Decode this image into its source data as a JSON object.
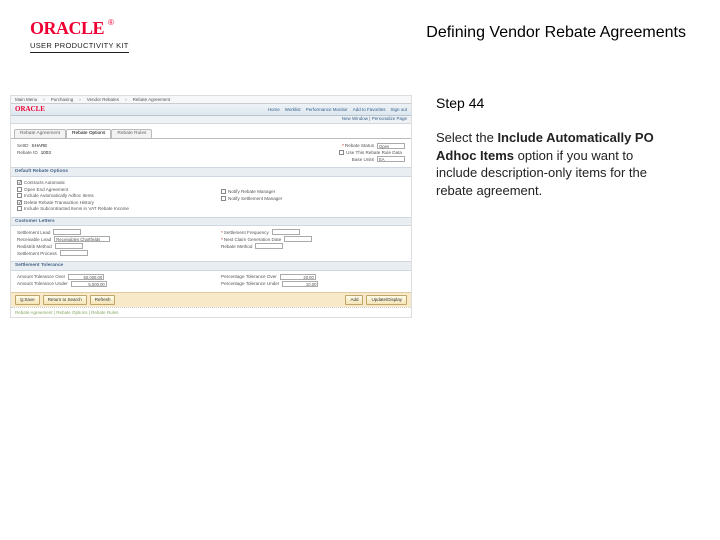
{
  "header": {
    "brand": "ORACLE",
    "brand_sub": "USER PRODUCTIVITY KIT",
    "title": "Defining Vendor Rebate Agreements"
  },
  "right": {
    "step": "Step 44",
    "instr_pre": "Select the ",
    "instr_bold": "Include Automatically PO Adhoc Items",
    "instr_post": " option if you want to include description-only items for the rebate agreement."
  },
  "mini": {
    "path_items": [
      "Main Menu",
      "Purchasing",
      "Vendor Rebates",
      "Rebate Agreement"
    ],
    "brand": "ORACLE",
    "nav": {
      "home": "Home",
      "worklist": "Worklist",
      "perf": "Performance Monitor",
      "add": "Add to Favorites",
      "signout": "Sign out"
    },
    "sub": {
      "win": "New Window",
      "pers": "Personalize Page"
    },
    "tabs": {
      "t0": "Rebate Agreement",
      "t1": "Rebate Options",
      "t2": "Rebate Rules"
    },
    "f1": {
      "setid_l": "SetID",
      "setid_v": "SHARE",
      "rid_l": "Rebate ID",
      "rid_v": "1003",
      "status_l": "Rebate Status",
      "status_v": "Open",
      "flag_l": "Use This Rebate Rule Data",
      "unit_l": "Base Units",
      "unit_v": "EA"
    },
    "sect1": {
      "title": "Default Rebate Options",
      "o0": "Contracts Automatic",
      "o1": "Open End Agreement",
      "o2": "Include Automatically Adhoc Items",
      "o3": "Delete Rebate Transaction History",
      "o4": "Include Subcontracted Items in VAT Rebate Income",
      "r0": "Notify Rebate Manager",
      "r1": "Notify Settlement Manager"
    },
    "sect2": {
      "title": "Customer   Letters",
      "a0": "Settlement Lead",
      "b0": "Settlement Frequency",
      "a1": "Receivable Lead",
      "a1v": "Receivables Chartfields",
      "b1": "Next Claim Generation Date",
      "a2": "Redistrib Method",
      "b2": "Rebate Method",
      "a3": "Settlement Process"
    },
    "sect3": {
      "title": "Settlement   Tolerance",
      "a0": "Amount Tolerance Over",
      "a0v": "50,000.00",
      "a1": "Amount Tolerance Under",
      "a1v": "5,000.00",
      "b0": "Percentage Tolerance Over",
      "b0v": "20.00",
      "b1": "Percentage Tolerance Under",
      "b1v": "10.00"
    },
    "btns": {
      "save": "Save",
      "ret": "Return to Search",
      "refresh": "Refresh",
      "add": "Add",
      "upd": "Update/Display"
    },
    "foot": "Rebate Agreement | Rebate Options | Rebate Rules"
  }
}
